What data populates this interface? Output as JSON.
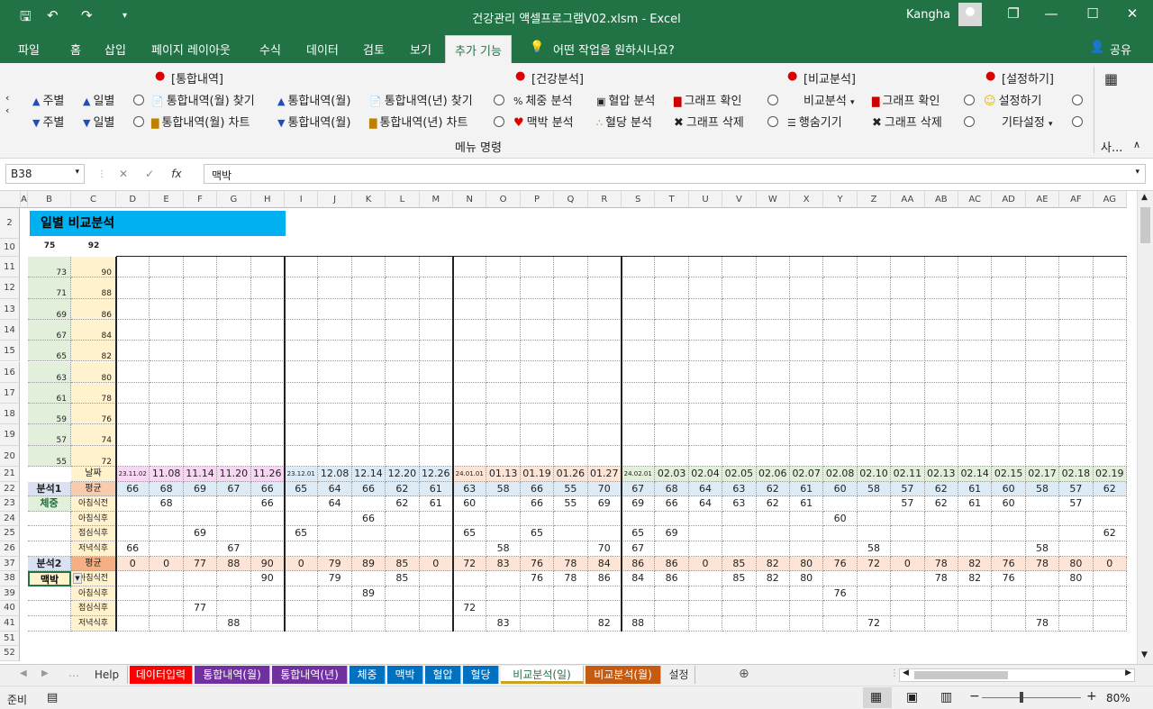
{
  "window": {
    "title": "건강관리 액셀프로그램V02.xlsm  -  Excel",
    "user": "Kangha",
    "share_label": "공유"
  },
  "tabs": [
    "파일",
    "홈",
    "삽입",
    "페이지 레이아웃",
    "수식",
    "데이터",
    "검토",
    "보기",
    "추가 기능"
  ],
  "tell_me": "어떤 작업을 원하시나요?",
  "ribbon": {
    "caption": "메뉴 명령",
    "groups": [
      "[통합내역]",
      "[건강분석]",
      "[비교분석]",
      "[설정하기]"
    ],
    "buttons_top": [
      "주별",
      "일별",
      "통합내역(월) 찾기",
      "통합내역(월)",
      "통합내역(년) 찾기",
      "체중 분석",
      "혈압 분석",
      "그래프 확인",
      "비교분석",
      "그래프 확인",
      "설정하기"
    ],
    "buttons_bottom": [
      "주별",
      "일별",
      "통합내역(월) 차트",
      "통합내역(월)",
      "통합내역(년) 차트",
      "맥박 분석",
      "혈당 분석",
      "그래프 삭제",
      "행숨기기",
      "그래프 삭제",
      "기타설정"
    ],
    "more_label": "사..."
  },
  "formula": {
    "name_box": "B38",
    "value": "맥박"
  },
  "columns": [
    "A",
    "B",
    "C",
    "D",
    "E",
    "F",
    "G",
    "H",
    "I",
    "J",
    "K",
    "L",
    "M",
    "N",
    "O",
    "P",
    "Q",
    "R",
    "S",
    "T",
    "U",
    "V",
    "W",
    "X",
    "Y",
    "Z",
    "AA",
    "AB",
    "AC",
    "AD",
    "AE",
    "AF",
    "AG"
  ],
  "sheet": {
    "title": "일별 비교분석",
    "scale_top": [
      "75",
      "92"
    ],
    "scale_b": [
      "73",
      "71",
      "69",
      "67",
      "65",
      "63",
      "61",
      "59",
      "57",
      "55"
    ],
    "scale_c": [
      "90",
      "88",
      "86",
      "84",
      "82",
      "80",
      "78",
      "76",
      "74",
      "72"
    ],
    "scale_rows": [
      "11",
      "12",
      "13",
      "14",
      "15",
      "16",
      "17",
      "18",
      "19",
      "20"
    ],
    "date_label": "날짜",
    "dates": [
      "23.11.02",
      "11.08",
      "11.14",
      "11.20",
      "11.26",
      "23.12.01",
      "12.08",
      "12.14",
      "12.20",
      "12.26",
      "24.01.01",
      "01.13",
      "01.19",
      "01.26",
      "01.27",
      "24.02.01",
      "02.03",
      "02.04",
      "02.05",
      "02.06",
      "02.07",
      "02.08",
      "02.10",
      "02.11",
      "02.13",
      "02.14",
      "02.15",
      "02.17",
      "02.18",
      "02.19"
    ],
    "sections": [
      {
        "name": "분석1",
        "metric": "체중",
        "avg_label": "평균",
        "avg": [
          "66",
          "68",
          "69",
          "67",
          "66",
          "65",
          "64",
          "66",
          "62",
          "61",
          "63",
          "58",
          "66",
          "55",
          "70",
          "67",
          "68",
          "64",
          "63",
          "62",
          "61",
          "60",
          "58",
          "57",
          "62",
          "61",
          "60",
          "58",
          "57",
          "62"
        ],
        "rows": [
          {
            "label": "아침식전",
            "values": [
              "",
              "68",
              "",
              "",
              "66",
              "",
              "64",
              "",
              "62",
              "61",
              "60",
              "",
              "66",
              "55",
              "69",
              "69",
              "66",
              "64",
              "63",
              "62",
              "61",
              "",
              "",
              "57",
              "62",
              "61",
              "60",
              "",
              "57",
              ""
            ]
          },
          {
            "label": "아침식후",
            "values": [
              "",
              "",
              "",
              "",
              "",
              "",
              "",
              "66",
              "",
              "",
              "",
              "",
              "",
              "",
              "",
              "",
              "",
              "",
              "",
              "",
              "",
              "60",
              "",
              "",
              "",
              "",
              "",
              "",
              "",
              ""
            ]
          },
          {
            "label": "점심식후",
            "values": [
              "",
              "",
              "69",
              "",
              "",
              "65",
              "",
              "",
              "",
              "",
              "65",
              "",
              "65",
              "",
              "",
              "65",
              "69",
              "",
              "",
              "",
              "",
              "",
              "",
              "",
              "",
              "",
              "",
              "",
              "",
              "62"
            ]
          },
          {
            "label": "저녁식후",
            "values": [
              "66",
              "",
              "",
              "67",
              "",
              "",
              "",
              "",
              "",
              "",
              "",
              "58",
              "",
              "",
              "70",
              "67",
              "",
              "",
              "",
              "",
              "",
              "",
              "58",
              "",
              "",
              "",
              "",
              "58",
              "",
              ""
            ]
          }
        ]
      },
      {
        "name": "분석2",
        "metric": "맥박",
        "avg_label": "평균",
        "avg": [
          "0",
          "0",
          "77",
          "88",
          "90",
          "0",
          "79",
          "89",
          "85",
          "0",
          "72",
          "83",
          "76",
          "78",
          "84",
          "86",
          "86",
          "0",
          "85",
          "82",
          "80",
          "76",
          "72",
          "0",
          "78",
          "82",
          "76",
          "78",
          "80",
          "0"
        ],
        "rows": [
          {
            "label": "아침식전",
            "values": [
              "",
              "",
              "",
              "",
              "90",
              "",
              "79",
              "",
              "85",
              "",
              "",
              "",
              "76",
              "78",
              "86",
              "84",
              "86",
              "",
              "85",
              "82",
              "80",
              "",
              "",
              "",
              "78",
              "82",
              "76",
              "",
              "80",
              ""
            ]
          },
          {
            "label": "아침식후",
            "values": [
              "",
              "",
              "",
              "",
              "",
              "",
              "",
              "89",
              "",
              "",
              "",
              "",
              "",
              "",
              "",
              "",
              "",
              "",
              "",
              "",
              "",
              "76",
              "",
              "",
              "",
              "",
              "",
              "",
              "",
              ""
            ]
          },
          {
            "label": "점심식후",
            "values": [
              "",
              "",
              "77",
              "",
              "",
              "",
              "",
              "",
              "",
              "",
              "72",
              "",
              "",
              "",
              "",
              "",
              "",
              "",
              "",
              "",
              "",
              "",
              "",
              "",
              "",
              "",
              "",
              "",
              "",
              ""
            ]
          },
          {
            "label": "저녁식후",
            "values": [
              "",
              "",
              "",
              "88",
              "",
              "",
              "",
              "",
              "",
              "",
              "",
              "83",
              "",
              "",
              "82",
              "88",
              "",
              "",
              "",
              "",
              "",
              "",
              "72",
              "",
              "",
              "",
              "",
              "78",
              "",
              ""
            ]
          }
        ]
      }
    ]
  },
  "sheet_tabs": [
    "Help",
    "데이터입력",
    "통합내역(월)",
    "통합내역(년)",
    "체중",
    "맥박",
    "혈압",
    "혈당",
    "비교분석(일)",
    "비교분석(월)",
    "설정"
  ],
  "sheet_tab_colors": [
    "#f0f0f0",
    "#ff0000",
    "#7030a0",
    "#7030a0",
    "#0070c0",
    "#0070c0",
    "#0070c0",
    "#0070c0",
    "#fff2cc",
    "#c55a11",
    "#f0f0f0"
  ],
  "active_sheet": "비교분석(일)",
  "status": {
    "ready": "준비",
    "zoom": "80%"
  }
}
